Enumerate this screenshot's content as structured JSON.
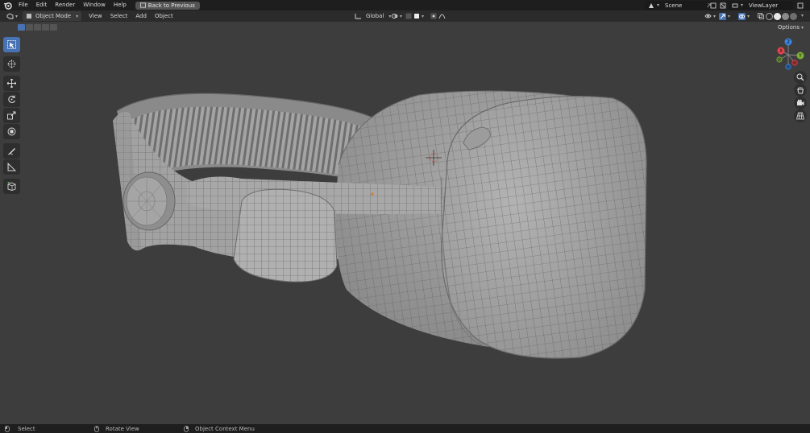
{
  "topbar": {
    "menus": [
      "File",
      "Edit",
      "Render",
      "Window",
      "Help"
    ],
    "back_button": "Back to Previous",
    "scene": "Scene",
    "view_layer": "ViewLayer"
  },
  "header": {
    "mode": "Object Mode",
    "menus": [
      "View",
      "Select",
      "Add",
      "Object"
    ],
    "orientation": "Global",
    "options_label": "Options"
  },
  "gizmo": {
    "axes": [
      "X",
      "Y",
      "Z"
    ],
    "colors": {
      "x": "#e8434f",
      "y": "#7cb034",
      "z": "#3b86e0"
    }
  },
  "statusbar": {
    "items": [
      "Select",
      "Rotate View",
      "Object Context Menu"
    ]
  },
  "icons": {
    "toolbar": [
      "select-box-icon",
      "cursor-icon",
      "move-icon",
      "rotate-icon",
      "scale-icon",
      "transform-icon",
      "annotate-icon",
      "measure-icon",
      "add-cube-icon"
    ],
    "nav": [
      "zoom-icon",
      "hand-icon",
      "camera-icon",
      "grid-icon"
    ]
  },
  "colors": {
    "accent": "#4772b3",
    "viewport": "#3d3d3d"
  }
}
